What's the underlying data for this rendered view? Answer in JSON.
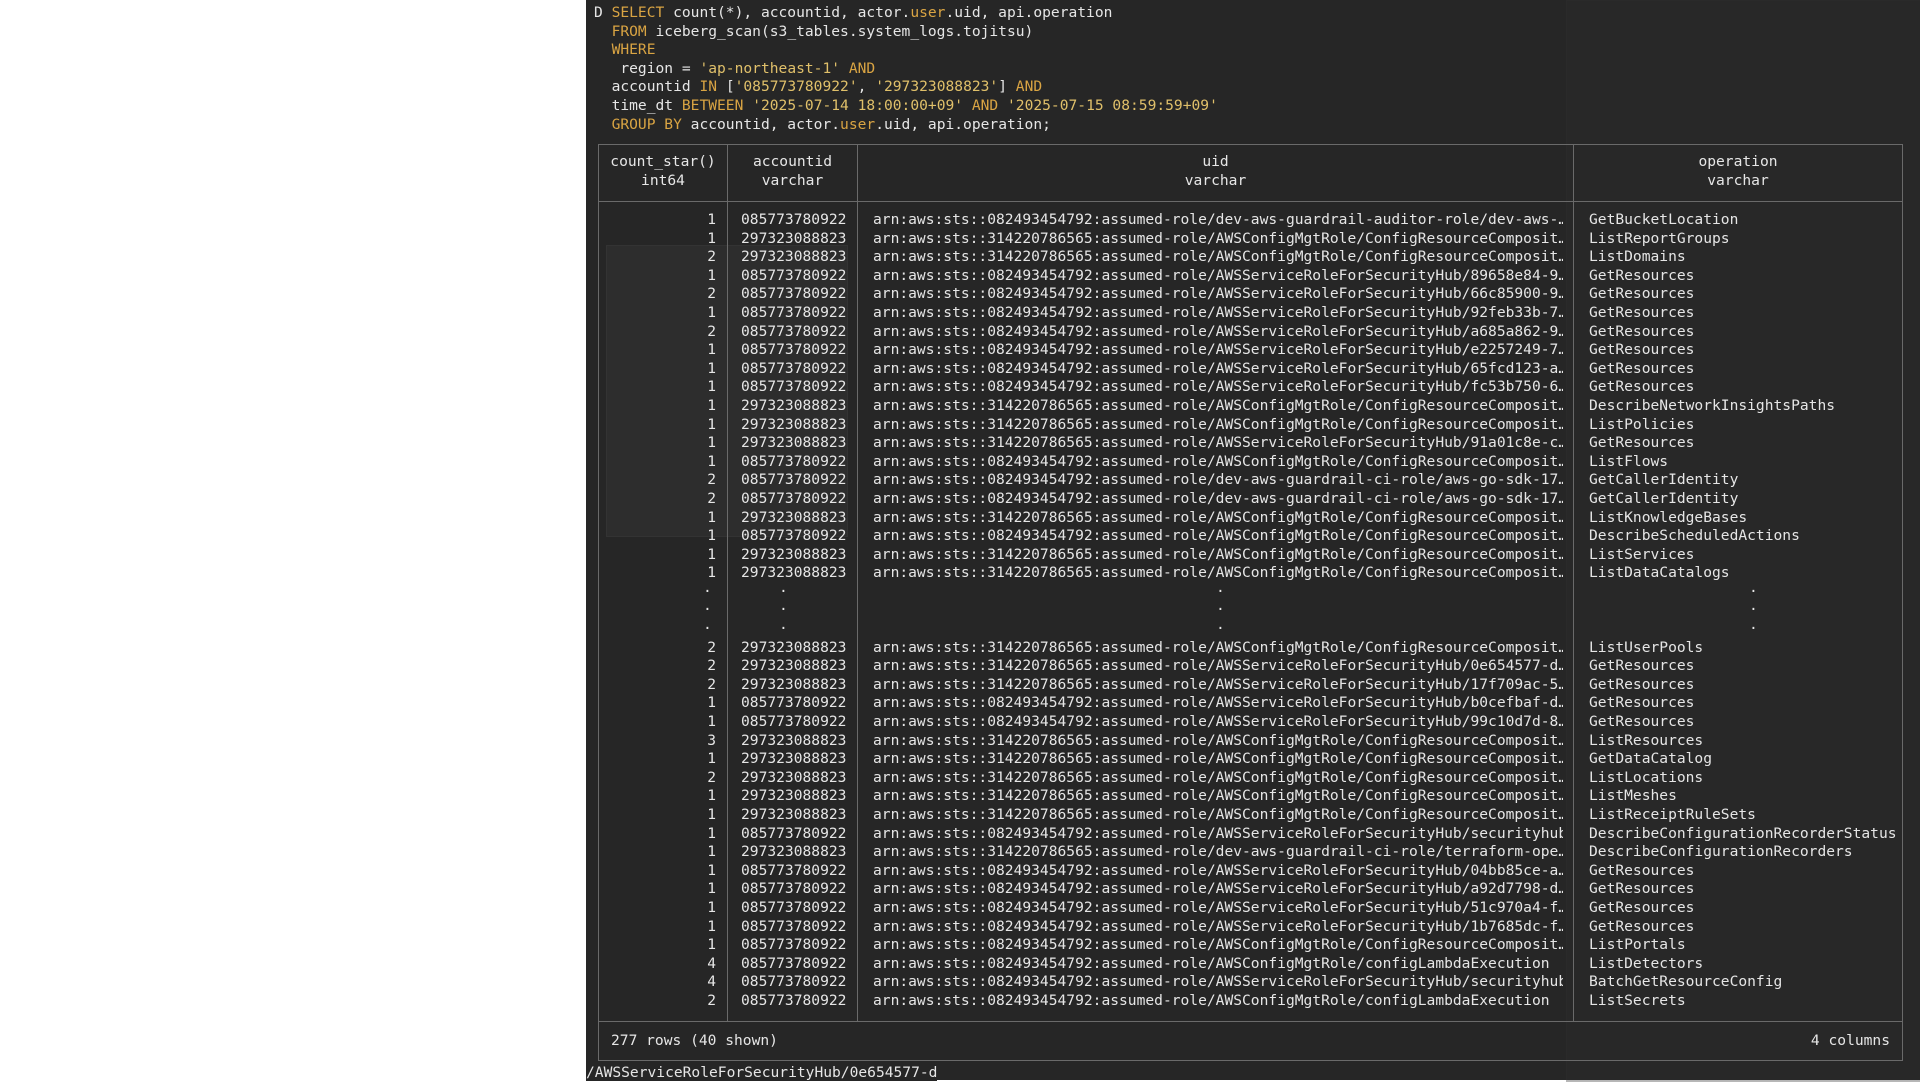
{
  "query": {
    "prompt": "D",
    "lines": [
      [
        "SELECT",
        " count(*), accountid, actor.",
        "user",
        ".uid, api.operation"
      ],
      [
        "FROM",
        " iceberg_scan(s3_tables.system_logs.tojitsu)"
      ],
      [
        "WHERE"
      ],
      [
        " region = ",
        "'ap-northeast-1'",
        " AND"
      ],
      [
        "accountid ",
        "IN",
        " [",
        "'085773780922'",
        ", ",
        "'297323088823'",
        "] ",
        "AND"
      ],
      [
        "time_dt ",
        "BETWEEN",
        " ",
        "'2025-07-14 18:00:00+09'",
        " AND ",
        "'2025-07-15 08:59:59+09'"
      ],
      [
        "GROUP BY",
        " accountid, actor.",
        "user",
        ".uid, api.operation;"
      ]
    ]
  },
  "table": {
    "columns": [
      {
        "name": "count_star()",
        "type": "int64"
      },
      {
        "name": "accountid",
        "type": "varchar"
      },
      {
        "name": "uid",
        "type": "varchar"
      },
      {
        "name": "operation",
        "type": "varchar"
      }
    ],
    "rows_top": [
      [
        "1",
        "085773780922",
        "arn:aws:sts::082493454792:assumed-role/dev-aws-guardrail-auditor-role/dev-aws-…",
        "GetBucketLocation"
      ],
      [
        "1",
        "297323088823",
        "arn:aws:sts::314220786565:assumed-role/AWSConfigMgtRole/ConfigResourceComposit…",
        "ListReportGroups"
      ],
      [
        "2",
        "297323088823",
        "arn:aws:sts::314220786565:assumed-role/AWSConfigMgtRole/ConfigResourceComposit…",
        "ListDomains"
      ],
      [
        "1",
        "085773780922",
        "arn:aws:sts::082493454792:assumed-role/AWSServiceRoleForSecurityHub/89658e84-9…",
        "GetResources"
      ],
      [
        "2",
        "085773780922",
        "arn:aws:sts::082493454792:assumed-role/AWSServiceRoleForSecurityHub/66c85900-9…",
        "GetResources"
      ],
      [
        "1",
        "085773780922",
        "arn:aws:sts::082493454792:assumed-role/AWSServiceRoleForSecurityHub/92feb33b-7…",
        "GetResources"
      ],
      [
        "2",
        "085773780922",
        "arn:aws:sts::082493454792:assumed-role/AWSServiceRoleForSecurityHub/a685a862-9…",
        "GetResources"
      ],
      [
        "1",
        "085773780922",
        "arn:aws:sts::082493454792:assumed-role/AWSServiceRoleForSecurityHub/e2257249-7…",
        "GetResources"
      ],
      [
        "1",
        "085773780922",
        "arn:aws:sts::082493454792:assumed-role/AWSServiceRoleForSecurityHub/65fcd123-a…",
        "GetResources"
      ],
      [
        "1",
        "085773780922",
        "arn:aws:sts::082493454792:assumed-role/AWSServiceRoleForSecurityHub/fc53b750-6…",
        "GetResources"
      ],
      [
        "1",
        "297323088823",
        "arn:aws:sts::314220786565:assumed-role/AWSConfigMgtRole/ConfigResourceComposit…",
        "DescribeNetworkInsightsPaths"
      ],
      [
        "1",
        "297323088823",
        "arn:aws:sts::314220786565:assumed-role/AWSConfigMgtRole/ConfigResourceComposit…",
        "ListPolicies"
      ],
      [
        "1",
        "297323088823",
        "arn:aws:sts::314220786565:assumed-role/AWSServiceRoleForSecurityHub/91a01c8e-c…",
        "GetResources"
      ],
      [
        "1",
        "085773780922",
        "arn:aws:sts::082493454792:assumed-role/AWSConfigMgtRole/ConfigResourceComposit…",
        "ListFlows"
      ],
      [
        "2",
        "085773780922",
        "arn:aws:sts::082493454792:assumed-role/dev-aws-guardrail-ci-role/aws-go-sdk-17…",
        "GetCallerIdentity"
      ],
      [
        "2",
        "085773780922",
        "arn:aws:sts::082493454792:assumed-role/dev-aws-guardrail-ci-role/aws-go-sdk-17…",
        "GetCallerIdentity"
      ],
      [
        "1",
        "297323088823",
        "arn:aws:sts::314220786565:assumed-role/AWSConfigMgtRole/ConfigResourceComposit…",
        "ListKnowledgeBases"
      ],
      [
        "1",
        "085773780922",
        "arn:aws:sts::082493454792:assumed-role/AWSConfigMgtRole/ConfigResourceComposit…",
        "DescribeScheduledActions"
      ],
      [
        "1",
        "297323088823",
        "arn:aws:sts::314220786565:assumed-role/AWSConfigMgtRole/ConfigResourceComposit…",
        "ListServices"
      ],
      [
        "1",
        "297323088823",
        "arn:aws:sts::314220786565:assumed-role/AWSConfigMgtRole/ConfigResourceComposit…",
        "ListDataCatalogs"
      ]
    ],
    "ellipsis": "·",
    "rows_bottom": [
      [
        "2",
        "297323088823",
        "arn:aws:sts::314220786565:assumed-role/AWSConfigMgtRole/ConfigResourceComposit…",
        "ListUserPools"
      ],
      [
        "2",
        "297323088823",
        "arn:aws:sts::314220786565:assumed-role/AWSServiceRoleForSecurityHub/0e654577-d…",
        "GetResources"
      ],
      [
        "2",
        "297323088823",
        "arn:aws:sts::314220786565:assumed-role/AWSServiceRoleForSecurityHub/17f709ac-5…",
        "GetResources"
      ],
      [
        "1",
        "085773780922",
        "arn:aws:sts::082493454792:assumed-role/AWSServiceRoleForSecurityHub/b0cefbaf-d…",
        "GetResources"
      ],
      [
        "1",
        "085773780922",
        "arn:aws:sts::082493454792:assumed-role/AWSServiceRoleForSecurityHub/99c10d7d-8…",
        "GetResources"
      ],
      [
        "3",
        "297323088823",
        "arn:aws:sts::314220786565:assumed-role/AWSConfigMgtRole/ConfigResourceComposit…",
        "ListResources"
      ],
      [
        "1",
        "297323088823",
        "arn:aws:sts::314220786565:assumed-role/AWSConfigMgtRole/ConfigResourceComposit…",
        "GetDataCatalog"
      ],
      [
        "2",
        "297323088823",
        "arn:aws:sts::314220786565:assumed-role/AWSConfigMgtRole/ConfigResourceComposit…",
        "ListLocations"
      ],
      [
        "1",
        "297323088823",
        "arn:aws:sts::314220786565:assumed-role/AWSConfigMgtRole/ConfigResourceComposit…",
        "ListMeshes"
      ],
      [
        "1",
        "297323088823",
        "arn:aws:sts::314220786565:assumed-role/AWSConfigMgtRole/ConfigResourceComposit…",
        "ListReceiptRuleSets"
      ],
      [
        "1",
        "085773780922",
        "arn:aws:sts::082493454792:assumed-role/AWSServiceRoleForSecurityHub/securityhub",
        "DescribeConfigurationRecorderStatus"
      ],
      [
        "1",
        "297323088823",
        "arn:aws:sts::314220786565:assumed-role/dev-aws-guardrail-ci-role/terraform-ope…",
        "DescribeConfigurationRecorders"
      ],
      [
        "1",
        "085773780922",
        "arn:aws:sts::082493454792:assumed-role/AWSServiceRoleForSecurityHub/04bb85ce-a…",
        "GetResources"
      ],
      [
        "1",
        "085773780922",
        "arn:aws:sts::082493454792:assumed-role/AWSServiceRoleForSecurityHub/a92d7798-d…",
        "GetResources"
      ],
      [
        "1",
        "085773780922",
        "arn:aws:sts::082493454792:assumed-role/AWSServiceRoleForSecurityHub/51c970a4-f…",
        "GetResources"
      ],
      [
        "1",
        "085773780922",
        "arn:aws:sts::082493454792:assumed-role/AWSServiceRoleForSecurityHub/1b7685dc-f…",
        "GetResources"
      ],
      [
        "1",
        "085773780922",
        "arn:aws:sts::082493454792:assumed-role/AWSConfigMgtRole/ConfigResourceComposit…",
        "ListPortals"
      ],
      [
        "4",
        "085773780922",
        "arn:aws:sts::082493454792:assumed-role/AWSConfigMgtRole/configLambdaExecution",
        "ListDetectors"
      ],
      [
        "4",
        "085773780922",
        "arn:aws:sts::082493454792:assumed-role/AWSServiceRoleForSecurityHub/securityhub",
        "BatchGetResourceConfig"
      ],
      [
        "2",
        "085773780922",
        "arn:aws:sts::082493454792:assumed-role/AWSConfigMgtRole/configLambdaExecution",
        "ListSecrets"
      ]
    ],
    "footer_rows": "277 rows (40 shown)",
    "footer_cols": "4 columns"
  },
  "bottom_line": "/AWSServiceRoleForSecurityHub/0e654577-d",
  "colors": {
    "background": "#262626",
    "keyword": "#d9a443",
    "string": "#e0c06a",
    "text": "#e6e6e6",
    "border": "#6a6a6a"
  }
}
